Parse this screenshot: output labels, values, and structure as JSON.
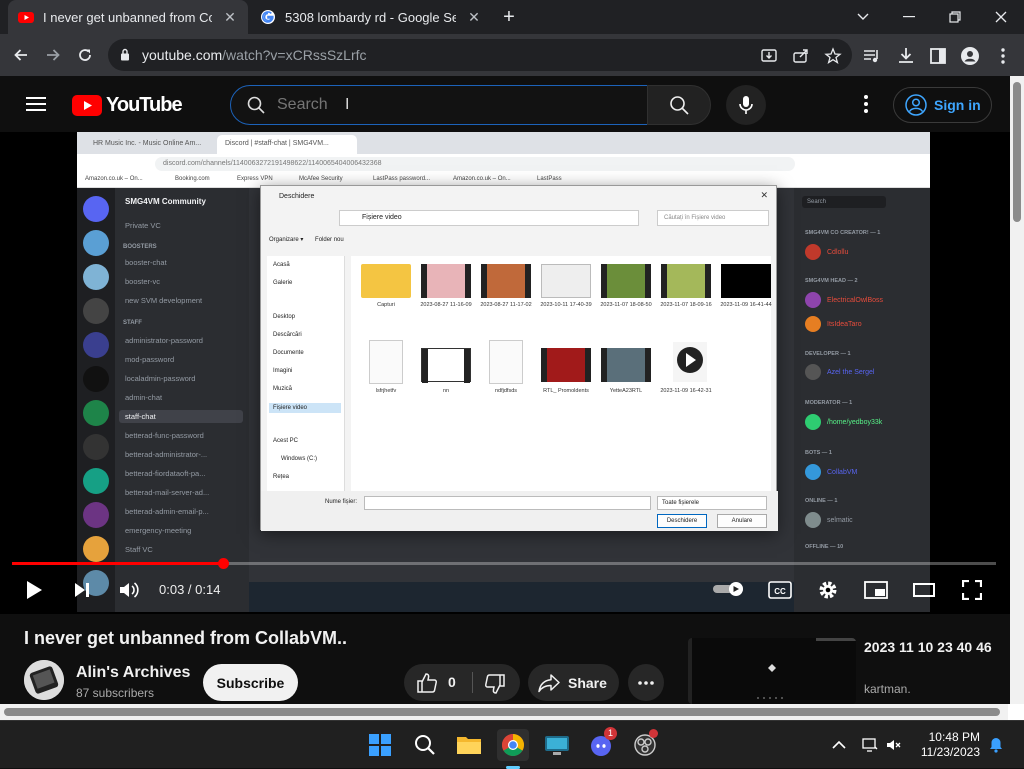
{
  "browser": {
    "tabs": [
      {
        "title": "I never get unbanned from Colla",
        "active": true,
        "favicon": "youtube-icon"
      },
      {
        "title": "5308 lombardy rd - Google Sear",
        "active": false,
        "favicon": "google-icon"
      }
    ],
    "url_host": "youtube.com",
    "url_path": "/watch?v=xCRssSzLrfc"
  },
  "youtube": {
    "logo_text": "YouTube",
    "search_placeholder": "Search",
    "signin_label": "Sign in"
  },
  "player": {
    "time": "0:03 / 0:14",
    "progress_fraction": 0.2143,
    "content": {
      "inner_tabs": [
        "HR Music Inc. - Music Online Am...",
        "Discord | #staff-chat | SMG4VM..."
      ],
      "inner_url": "discord.com/channels/1140063272191498622/1140065404006432368",
      "bookmarks": [
        "Amazon.co.uk – On...",
        "Booking.com",
        "Express VPN",
        "McAfee Security",
        "LastPass password...",
        "Amazon.co.uk – On...",
        "LastPass"
      ],
      "server_name": "SMG4VM Community",
      "channels_top": [
        "Private VC"
      ],
      "category_boosters": "BOOSTERS",
      "booster_channels": [
        "booster-chat",
        "booster-vc",
        "new SVM development"
      ],
      "category_staff": "STAFF",
      "staff_channels": [
        "administrator-password",
        "mod-password",
        "localadmin-password",
        "admin-chat",
        "staff-chat",
        "betterad-func-password",
        "betterad-administrator-...",
        "betterad-fiordataoft-pa...",
        "betterad-mail-server-ad...",
        "betterad-admin-email-p...",
        "emergency-meeting",
        "Staff VC"
      ],
      "selected_channel": "staff-chat",
      "dialog_title": "Deschidere",
      "dialog_path": "Fișiere video",
      "dialog_search": "Căutați în Fișiere video",
      "dialog_organize": "Organizare ▾",
      "dialog_new_folder": "Folder nou",
      "dialog_nav": [
        "Acasă",
        "Galerie",
        "Desktop",
        "Descărcări",
        "Documente",
        "Imagini",
        "Muzică",
        "Fișiere video",
        "Acest PC",
        "Windows (C:)",
        "Rețea"
      ],
      "files_row1": [
        "Capturi",
        "2023-08-27 11-16-09",
        "2023-08-27 11-17-02",
        "2023-10-11 17-40-39",
        "2023-11-07 18-08-50",
        "2023-11-07 18-09-16",
        "2023-11-09 16-41-44"
      ],
      "files_row2": [
        "lsfrjhetfv",
        "nn",
        "ndfjdfsds",
        "RTL_ Promoldents",
        "YetteA23RTL",
        "2023-11-09 16-42-31"
      ],
      "dialog_filename_label": "Nume fișier:",
      "dialog_filetype": "Toate fișierele",
      "dialog_open": "Deschidere",
      "dialog_cancel": "Anulare",
      "members_search": "Search",
      "members": [
        {
          "category": "SMG4VM CO CREATOR! — 1",
          "name": "Cdlollu",
          "color": "#e74c3c"
        },
        {
          "category": "SMG4VM HEAD — 2",
          "name": "ElectricalOwlBoss",
          "color": "#e74c3c"
        },
        {
          "category": "",
          "name": "ItsIdeaTaro",
          "color": "#e74c3c"
        },
        {
          "category": "DEVELOPER — 1",
          "name": "Azel the Sergel",
          "color": "#5865f2"
        },
        {
          "category": "MODERATOR — 1",
          "name": "/home/yedboy33k",
          "color": "#57f287"
        },
        {
          "category": "BOTS — 1",
          "name": "CollabVM",
          "color": "#5865f2"
        },
        {
          "category": "ONLINE — 1",
          "name": "selmatic",
          "color": "#949ba4"
        }
      ],
      "offline_label": "OFFLINE — 10"
    }
  },
  "video": {
    "title": "I never get unbanned from CollabVM..",
    "channel": "Alin's Archives",
    "subscribers": "87 subscribers",
    "subscribe_label": "Subscribe",
    "likes": "0",
    "share_label": "Share"
  },
  "recommendation": {
    "title": "2023 11 10 23 40 46",
    "channel": "kartman."
  },
  "taskbar": {
    "time": "10:48 PM",
    "date": "11/23/2023",
    "discord_badge": "1"
  },
  "colors": {
    "youtube_red": "#ff0000",
    "link_blue": "#3ea6ff",
    "chrome_dark": "#202124",
    "discord_bg": "#313338"
  }
}
